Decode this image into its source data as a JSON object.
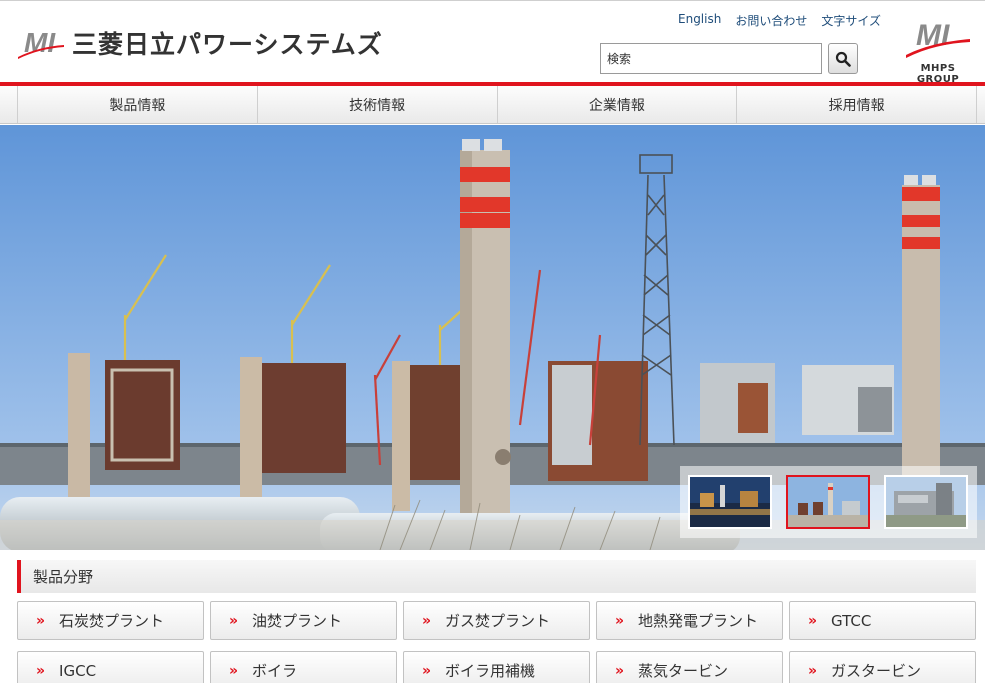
{
  "header": {
    "company_name": "三菱日立パワーシステムズ",
    "logo_mark": "MI",
    "group_logo_text": "MHPS GROUP",
    "utility_links": [
      "English",
      "お問い合わせ",
      "文字サイズ"
    ],
    "search": {
      "value": "検索",
      "button_icon": "search-icon"
    }
  },
  "nav": {
    "items": [
      "製品情報",
      "技術情報",
      "企業情報",
      "採用情報"
    ]
  },
  "hero": {
    "thumbnails": [
      "power-plant-night",
      "power-plant-construction",
      "power-plant-building"
    ],
    "active_thumbnail": 1
  },
  "products": {
    "title": "製品分野",
    "rows": [
      [
        "石炭焚プラント",
        "油焚プラント",
        "ガス焚プラント",
        "地熱発電プラント",
        "GTCC"
      ],
      [
        "IGCC",
        "ボイラ",
        "ボイラ用補機",
        "蒸気タービン",
        "ガスタービン"
      ]
    ],
    "arrow": "»"
  },
  "colors": {
    "accent": "#e0141e",
    "link": "#1f4d7a"
  }
}
